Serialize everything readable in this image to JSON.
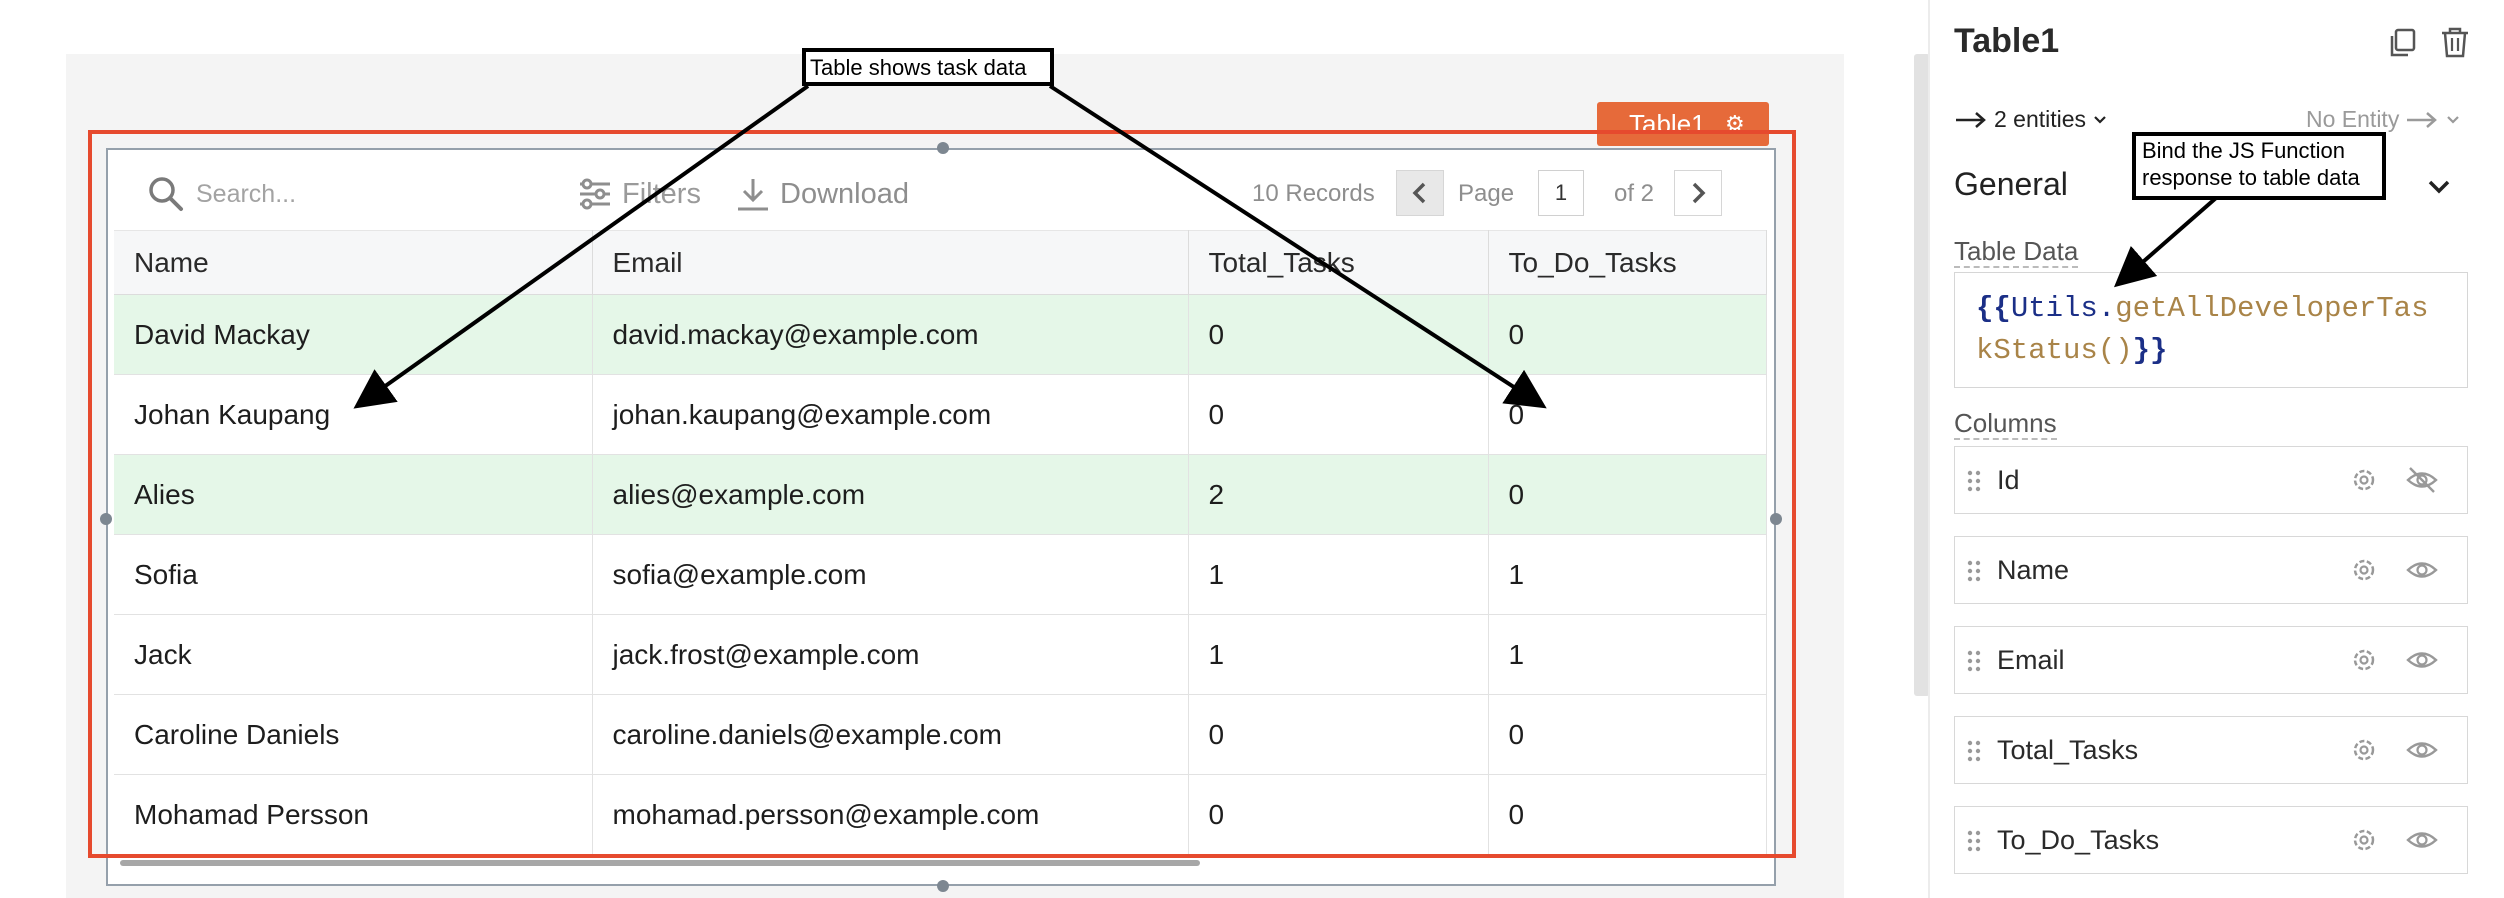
{
  "canvas": {
    "widget_tag": "Table1",
    "table": {
      "search_placeholder": "Search...",
      "filters_label": "Filters",
      "download_label": "Download",
      "records_label": "10 Records",
      "page_label": "Page",
      "current_page": "1",
      "total_pages_label": "of 2",
      "columns": [
        "Name",
        "Email",
        "Total_Tasks",
        "To_Do_Tasks"
      ],
      "rows": [
        {
          "name": "David Mackay",
          "email": "david.mackay@example.com",
          "total_tasks": "0",
          "to_do_tasks": "0",
          "highlighted": true
        },
        {
          "name": "Johan Kaupang",
          "email": "johan.kaupang@example.com",
          "total_tasks": "0",
          "to_do_tasks": "0",
          "highlighted": false
        },
        {
          "name": "Alies",
          "email": "alies@example.com",
          "total_tasks": "2",
          "to_do_tasks": "0",
          "highlighted": true
        },
        {
          "name": "Sofia",
          "email": "sofia@example.com",
          "total_tasks": "1",
          "to_do_tasks": "1",
          "highlighted": false
        },
        {
          "name": "Jack",
          "email": "jack.frost@example.com",
          "total_tasks": "1",
          "to_do_tasks": "1",
          "highlighted": false
        },
        {
          "name": "Caroline Daniels",
          "email": "caroline.daniels@example.com",
          "total_tasks": "0",
          "to_do_tasks": "0",
          "highlighted": false
        },
        {
          "name": "Mohamad Persson",
          "email": "mohamad.persson@example.com",
          "total_tasks": "0",
          "to_do_tasks": "0",
          "highlighted": false
        }
      ]
    }
  },
  "annotations": {
    "table_callout": "Table shows task data",
    "js_callout_line1": "Bind the JS Function",
    "js_callout_line2": "response to table data"
  },
  "panel": {
    "title": "Table1",
    "entities_label": "2 entities",
    "no_entity_label": "No Entity",
    "section_label": "General",
    "table_data_label": "Table Data",
    "code": {
      "open": "{{",
      "object": "Utils.",
      "function": "getAllDeveloperTaskStatus()",
      "close": "}}"
    },
    "columns_label": "Columns",
    "columns": [
      {
        "name": "Id",
        "visible": false
      },
      {
        "name": "Name",
        "visible": true
      },
      {
        "name": "Email",
        "visible": true
      },
      {
        "name": "Total_Tasks",
        "visible": true
      },
      {
        "name": "To_Do_Tasks",
        "visible": true
      }
    ]
  },
  "colors": {
    "accent_orange": "#e66a3a",
    "highlight_red": "#e64a2e",
    "row_highlight": "#e5f7e8",
    "code_blue": "#1b2f87",
    "code_gold": "#a98448"
  },
  "icons": [
    "search-icon",
    "filter-icon",
    "download-icon",
    "chevron-left-icon",
    "chevron-right-icon",
    "gear-icon",
    "copy-icon",
    "trash-icon",
    "chevron-down-icon",
    "drag-handle-icon",
    "eye-icon",
    "eye-off-icon",
    "arrow-right-icon"
  ]
}
